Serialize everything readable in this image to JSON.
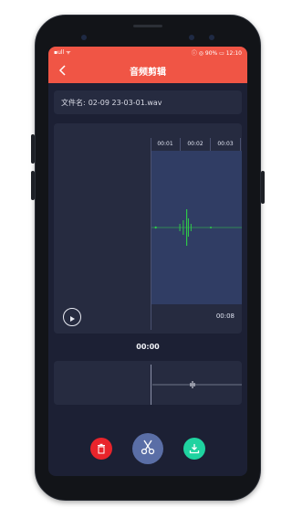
{
  "status_bar": {
    "left_text": "▪ull ᯤ",
    "right_text": "ⓘ ◎ 90% ▭ 12:10"
  },
  "header": {
    "title": "音频剪辑"
  },
  "file": {
    "label": "文件名:",
    "name": "02-09 23-03-01.wav"
  },
  "timeline": {
    "ticks": [
      "00:01",
      "00:02",
      "00:03"
    ]
  },
  "player": {
    "duration": "00:08",
    "current_time": "00:00"
  },
  "colors": {
    "accent": "#f05545",
    "panel": "#262b40",
    "wave": "#2fcf48",
    "delete": "#e9242b",
    "cut": "#5a6ea6",
    "export": "#1fd3a0"
  },
  "icons": {
    "back": "chevron-left-icon",
    "play": "play-icon",
    "delete": "trash-icon",
    "cut": "scissors-icon",
    "export": "download-icon"
  }
}
